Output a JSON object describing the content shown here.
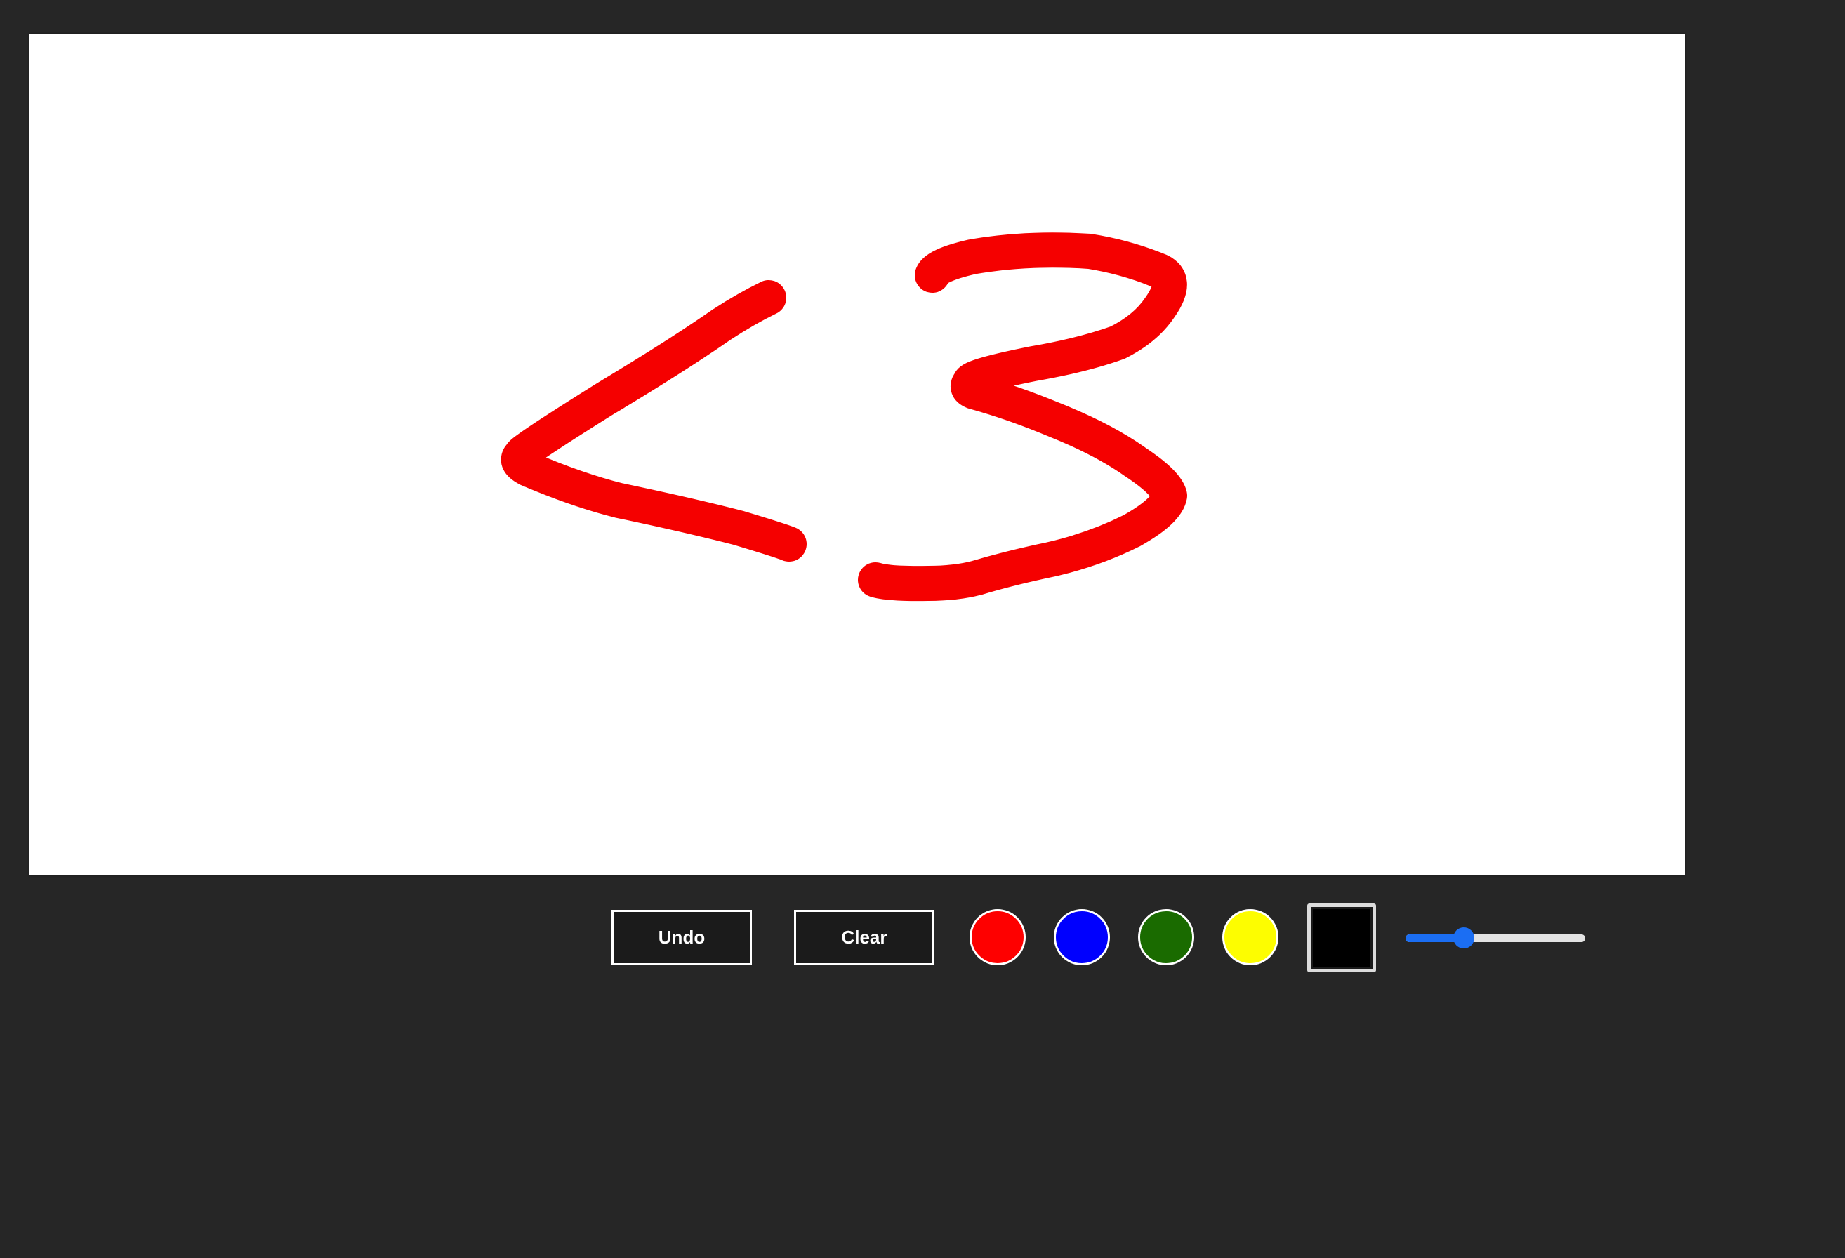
{
  "canvas": {
    "background": "#ffffff",
    "stroke_color": "#f50000",
    "drawing": "<3"
  },
  "toolbar": {
    "undo_label": "Undo",
    "clear_label": "Clear",
    "swatches": [
      {
        "name": "red",
        "color": "#fe0000"
      },
      {
        "name": "blue",
        "color": "#0000fe"
      },
      {
        "name": "green",
        "color": "#1a6b00"
      },
      {
        "name": "yellow",
        "color": "#fdfd00"
      }
    ],
    "custom_color": "#000000",
    "brush_size": {
      "fraction": 0.3
    }
  }
}
